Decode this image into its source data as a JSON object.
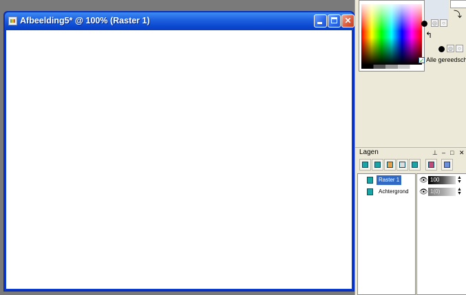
{
  "window": {
    "title": "Afbeelding5* @ 100% (Raster 1)",
    "buttons": {
      "minimize": "minimize",
      "maximize": "maximize",
      "close": "✕"
    },
    "canvas_color": "#ffffff"
  },
  "materials": {
    "checkbox_label": "Alle gereedschap",
    "checkbox_checked": true
  },
  "layers": {
    "title": "Lagen",
    "pin": "⊥",
    "minus": "–",
    "box": "□",
    "close": "✕",
    "items": [
      {
        "name": "Raster 1",
        "selected": true,
        "opacity": "100"
      },
      {
        "name": "Achtergrond",
        "selected": false,
        "opacity": "1(0)"
      }
    ]
  },
  "colors": {
    "titlebar": "#1f62e0",
    "selection": "#316ac5",
    "panel": "#ece9d8"
  }
}
